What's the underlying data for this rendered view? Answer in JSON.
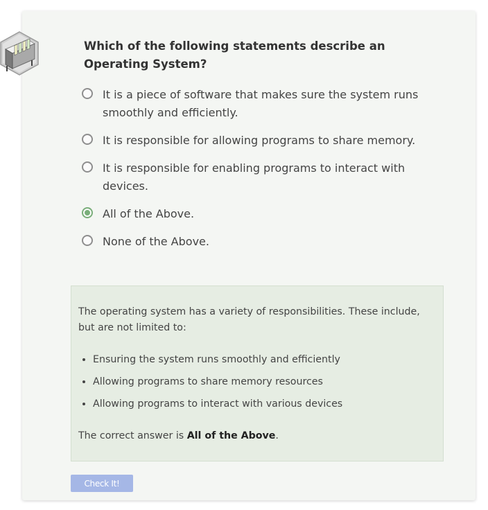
{
  "question": {
    "text": "Which of the following statements describe an Operating System?"
  },
  "options": [
    {
      "label": "It is a piece of software that makes sure the system runs smoothly and efficiently.",
      "selected": false
    },
    {
      "label": "It is responsible for allowing programs to share memory.",
      "selected": false
    },
    {
      "label": "It is responsible for enabling programs to interact with devices.",
      "selected": false
    },
    {
      "label": "All of the Above.",
      "selected": true
    },
    {
      "label": "None of the Above.",
      "selected": false
    }
  ],
  "feedback": {
    "intro": "The operating system has a variety of responsibilities. These include, but are not limited to:",
    "bullets": [
      "Ensuring the system runs smoothly and efficiently",
      "Allowing programs to share memory resources",
      "Allowing programs to interact with various devices"
    ],
    "answer_prefix": "The correct answer is ",
    "answer_bold": "All of the Above",
    "answer_suffix": "."
  },
  "check_button": {
    "label": "Check It!"
  },
  "colors": {
    "card_background": "#f4f6f3",
    "feedback_background": "#e6ede3",
    "selected_radio": "#7aae7a",
    "button": "#a5b7e6"
  },
  "icons": {
    "badge": "rack-hexagon-icon"
  }
}
